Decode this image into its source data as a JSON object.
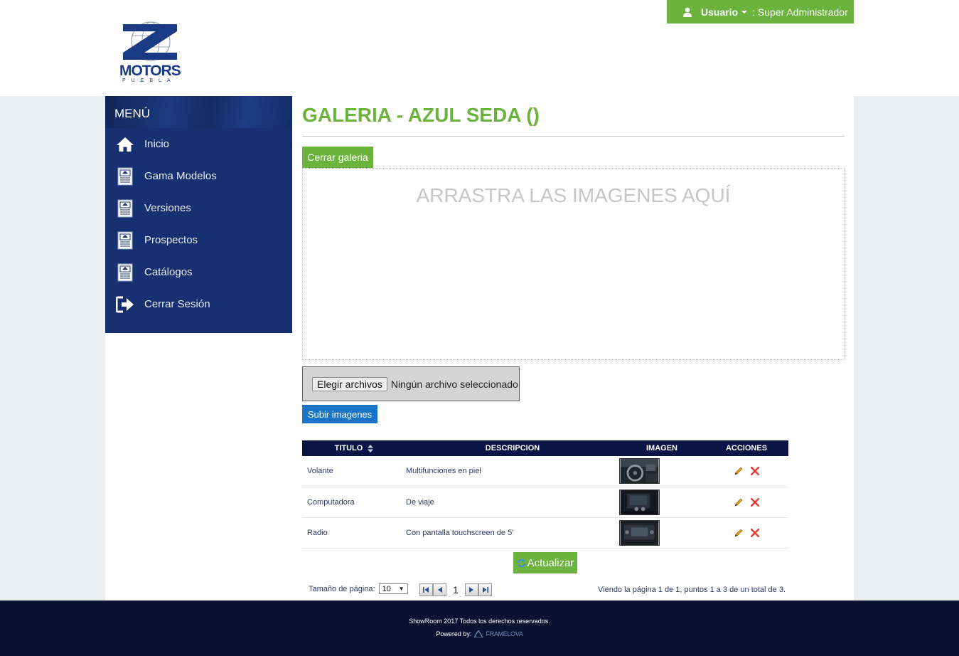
{
  "header": {
    "logo_text": "MOTORS",
    "logo_sub": "PUEBLA",
    "user_label": "Usuario",
    "user_name": ": Super Administrador"
  },
  "sidebar": {
    "title": "MENÚ",
    "items": [
      {
        "label": "Inicio",
        "icon": "home-icon"
      },
      {
        "label": "Gama Modelos",
        "icon": "document-icon"
      },
      {
        "label": "Versiones",
        "icon": "document-icon"
      },
      {
        "label": "Prospectos",
        "icon": "document-icon"
      },
      {
        "label": "Catálogos",
        "icon": "document-icon"
      },
      {
        "label": "Cerrar Sesión",
        "icon": "logout-icon"
      }
    ]
  },
  "main": {
    "title": "GALERIA - AZUL SEDA ()",
    "close_gallery": "Cerrar galeria",
    "dropzone_text": "ARRASTRA LAS IMAGENES AQUÍ",
    "file_button": "Elegir archivos",
    "file_status": "Ningún archivo seleccionado",
    "upload_button": "Subir imagenes",
    "refresh_button": "Actualizar"
  },
  "table": {
    "headers": [
      "TITULO",
      "DESCRIPCION",
      "IMAGEN",
      "ACCIONES"
    ],
    "rows": [
      {
        "titulo": "Volante",
        "descripcion": "Multifunciones en piel"
      },
      {
        "titulo": "Computadora",
        "descripcion": "De viaje"
      },
      {
        "titulo": "Radio",
        "descripcion": "Con pantalla touchscreen de 5'"
      }
    ]
  },
  "pager": {
    "size_label": "Tamaño de página:",
    "size_value": "10",
    "current_page": "1",
    "info": "Viendo la página 1 de 1, puntos 1 a 3 de un total de 3."
  },
  "footer": {
    "copyright": "ShowRoom 2017 Todos los derechos reservados.",
    "powered_by": "Powered by:",
    "brand": "FRAMELOVA"
  },
  "colors": {
    "accent_green": "#6cb33e",
    "sidebar_blue": "#173071",
    "table_header": "#0b1447",
    "upload_blue": "#1a75c8",
    "footer": "#0b1130"
  }
}
